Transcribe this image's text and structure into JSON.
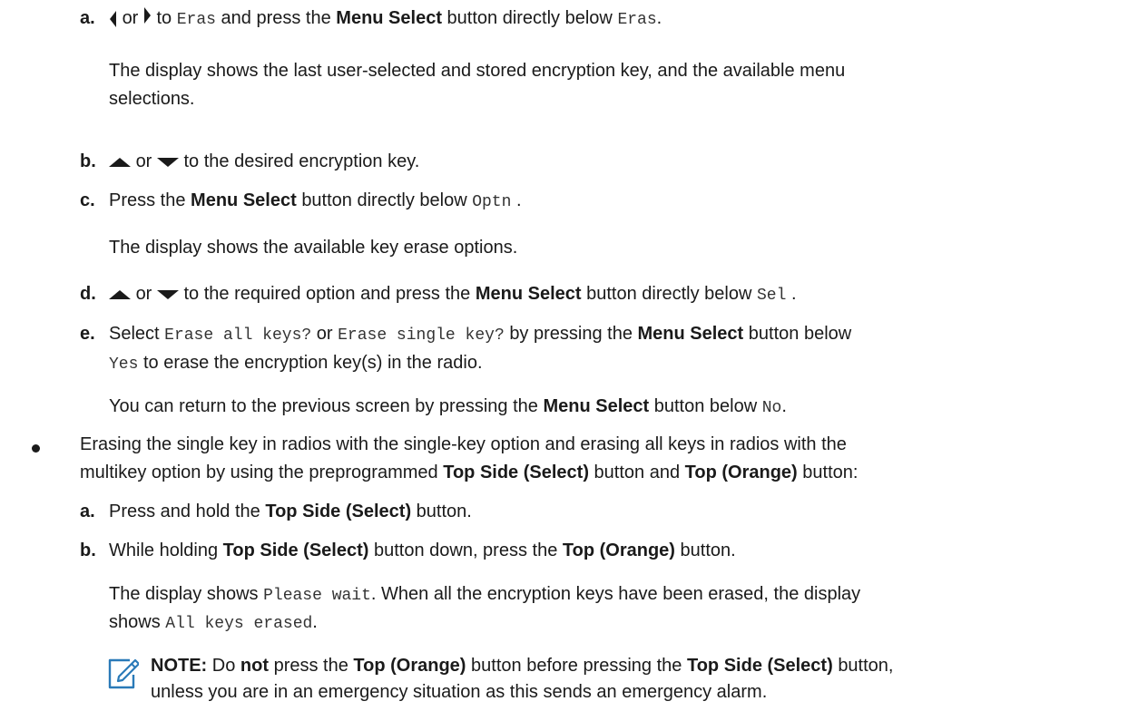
{
  "a1": {
    "marker": "a.",
    "or": "or",
    "t1": "to",
    "code1": "Eras",
    "t2": "and press the",
    "b1": "Menu Select",
    "t3": "button directly below",
    "code2": "Eras",
    "end": "."
  },
  "a1_desc": "The display shows the last user-selected and stored encryption key, and the available menu selections.",
  "b1": {
    "marker": "b.",
    "or": "or",
    "text": "to the desired encryption key."
  },
  "c1": {
    "marker": "c.",
    "t1": "Press the",
    "b1": "Menu Select",
    "t2": "button directly below",
    "code": "Optn",
    "end": "."
  },
  "c1_desc": "The display shows the available key erase options.",
  "d1": {
    "marker": "d.",
    "or": "or",
    "t1": "to the required option and press the",
    "b1": "Menu Select",
    "t2": "button directly below",
    "code": "Sel",
    "end": "."
  },
  "e1": {
    "marker": "e.",
    "t1": "Select",
    "code1": "Erase all keys?",
    "or": "or",
    "code2": "Erase single key?",
    "t2": "by pressing the",
    "b1": "Menu Select",
    "t3": "button below",
    "code3": "Yes",
    "t4": "to erase the encryption key(s) in the radio."
  },
  "e1_desc": {
    "t1": "You can return to the previous screen by pressing the",
    "b1": "Menu Select",
    "t2": "button below",
    "code": "No",
    "end": "."
  },
  "bullet": {
    "line1": "Erasing the single key in radios with the single-key option and erasing all keys in radios with the",
    "t1": "multikey option by using the preprogrammed",
    "b1": "Top Side (Select)",
    "t2": "button and",
    "b2": "Top (Orange)",
    "t3": "button:"
  },
  "a2": {
    "marker": "a.",
    "t1": "Press and hold the",
    "b1": "Top Side (Select)",
    "t2": "button."
  },
  "b2": {
    "marker": "b.",
    "t1": "While holding",
    "b1": "Top Side (Select)",
    "t2": "button down, press the",
    "b2": "Top (Orange)",
    "t3": "button."
  },
  "b2_desc": {
    "t1": "The display shows",
    "code1": "Please wait",
    "t2": ". When all the encryption keys have been erased, the display",
    "t3": "shows",
    "code2": "All keys erased",
    "end": "."
  },
  "note": {
    "label": "NOTE:",
    "t1": "Do",
    "b1": "not",
    "t2": "press the",
    "b2": "Top (Orange)",
    "t3": "button before pressing the",
    "b3": "Top Side (Select)",
    "t4": "button,",
    "line2": "unless you are in an emergency situation as this sends an emergency alarm."
  }
}
